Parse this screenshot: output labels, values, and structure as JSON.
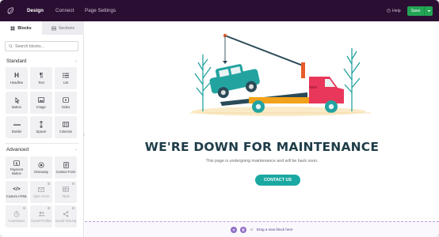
{
  "topbar": {
    "nav": [
      "Design",
      "Connect",
      "Page Settings"
    ],
    "help_label": "Help",
    "save_label": "Save"
  },
  "sidebar": {
    "tabs": [
      "Blocks",
      "Sections"
    ],
    "search_placeholder": "Search blocks...",
    "standard": {
      "title": "Standard",
      "items": [
        "Headline",
        "Text",
        "List",
        "Button",
        "Image",
        "Video",
        "Divider",
        "Spacer",
        "Columns"
      ]
    },
    "advanced": {
      "title": "Advanced",
      "items": [
        "Payment Button",
        "Giveaway",
        "Contact Form",
        "Custom HTML",
        "Optin Form",
        "Table",
        "Countdown",
        "Social Profiles",
        "Social Sharing"
      ]
    }
  },
  "canvas": {
    "headline": "WE'RE DOWN FOR MAINTENANCE",
    "subtext": "This page is undergoing maintenance and will be back soon.",
    "button_label": "CONTACT US"
  },
  "dropzone": {
    "or": "or",
    "label": "Drag a new block here"
  },
  "colors": {
    "topbar": "#2b0f32",
    "save": "#23a455",
    "accent": "#1aa9a2",
    "headline": "#1e3d48",
    "truck_red": "#e8375a",
    "truck_teal": "#22a3a0"
  }
}
